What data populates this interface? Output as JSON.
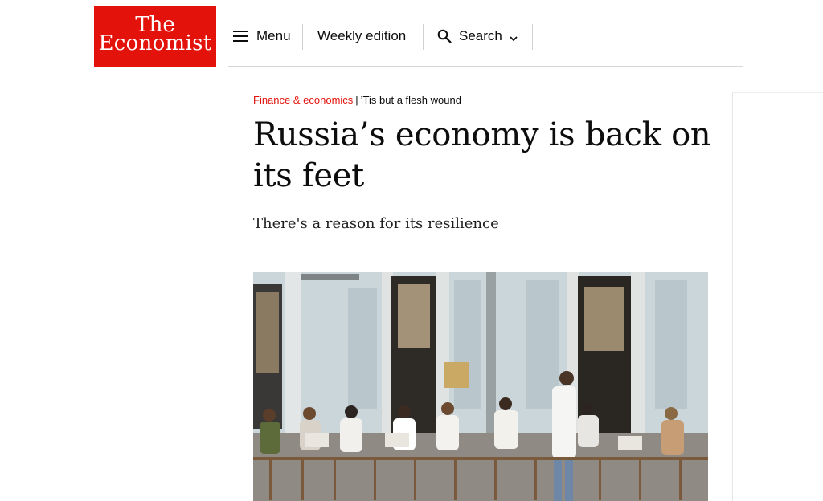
{
  "brand": {
    "line1": "The",
    "line2": "Economist",
    "color": "#e3120b"
  },
  "nav": {
    "menu_label": "Menu",
    "weekly_label": "Weekly edition",
    "search_label": "Search"
  },
  "article": {
    "section": "Finance & economics",
    "separator": "|",
    "rubric": "’Tis but a flesh wound",
    "headline": "Russia’s economy is back on its feet",
    "subheadline": "There's a reason for its resilience"
  },
  "icons": {
    "menu": "hamburger-icon",
    "search": "search-icon",
    "dropdown": "chevron-down-icon"
  }
}
